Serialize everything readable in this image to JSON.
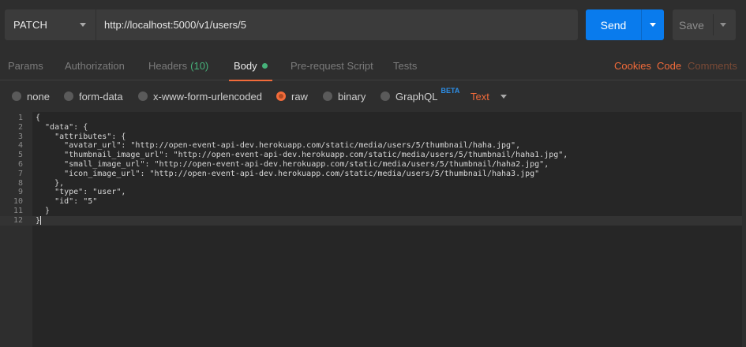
{
  "request": {
    "method": "PATCH",
    "url": "http://localhost:5000/v1/users/5",
    "send_label": "Send",
    "save_label": "Save"
  },
  "tabs": [
    {
      "label": "Params"
    },
    {
      "label": "Authorization"
    },
    {
      "label": "Headers",
      "count": "(10)"
    },
    {
      "label": "Body"
    },
    {
      "label": "Pre-request Script"
    },
    {
      "label": "Tests"
    }
  ],
  "right_links": [
    {
      "label": "Cookies",
      "color": "#f26b3a"
    },
    {
      "label": "Code",
      "color": "#f26b3a"
    },
    {
      "label": "Comments",
      "color": "#7a4a36"
    }
  ],
  "body_types": [
    {
      "label": "none",
      "selected": false
    },
    {
      "label": "form-data",
      "selected": false
    },
    {
      "label": "x-www-form-urlencoded",
      "selected": false
    },
    {
      "label": "raw",
      "selected": true
    },
    {
      "label": "binary",
      "selected": false
    },
    {
      "label": "GraphQL",
      "badge": "BETA",
      "selected": false
    }
  ],
  "format": "Text",
  "colors": {
    "accent": "#f26b3a",
    "send": "#097bed",
    "status_green": "#46b27a"
  },
  "editor": {
    "lines": [
      {
        "n": "1",
        "text": "{"
      },
      {
        "n": "2",
        "text": "  \"data\": {"
      },
      {
        "n": "3",
        "text": "    \"attributes\": {"
      },
      {
        "n": "4",
        "text": "      \"avatar_url\": \"http://open-event-api-dev.herokuapp.com/static/media/users/5/thumbnail/haha.jpg\","
      },
      {
        "n": "5",
        "text": "      \"thumbnail_image_url\": \"http://open-event-api-dev.herokuapp.com/static/media/users/5/thumbnail/haha1.jpg\","
      },
      {
        "n": "6",
        "text": "      \"small_image_url\": \"http://open-event-api-dev.herokuapp.com/static/media/users/5/thumbnail/haha2.jpg\","
      },
      {
        "n": "7",
        "text": "      \"icon_image_url\": \"http://open-event-api-dev.herokuapp.com/static/media/users/5/thumbnail/haha3.jpg\""
      },
      {
        "n": "8",
        "text": "    },"
      },
      {
        "n": "9",
        "text": "    \"type\": \"user\","
      },
      {
        "n": "10",
        "text": "    \"id\": \"5\""
      },
      {
        "n": "11",
        "text": "  }"
      },
      {
        "n": "12",
        "text": "}"
      }
    ]
  }
}
